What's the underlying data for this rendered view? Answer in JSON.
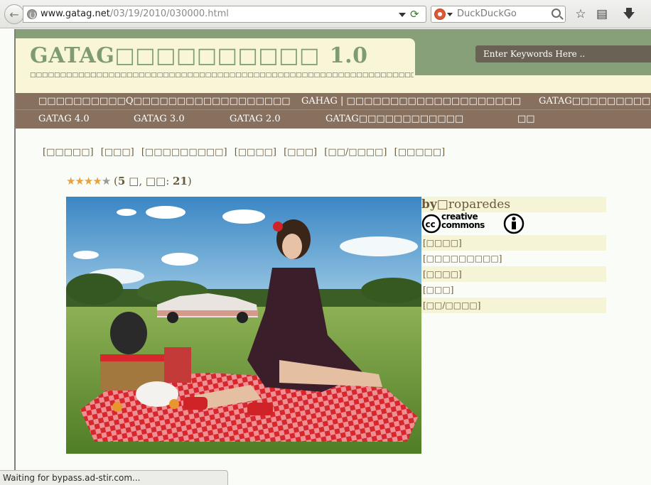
{
  "browser": {
    "url_domain": "www.gatag.net",
    "url_path": "/03/19/2010/030000.html",
    "search_placeholder": "DuckDuckGo",
    "status_text": "Waiting for bypass.ad-stir.com..."
  },
  "site": {
    "title": "GATAG□□□□□□□□□□",
    "version": "1.0",
    "tagline": "□□□□□□□□□□□□□□□□□□□□□□□□□□□□□□□□□□□□□□□□□□□□□□□□□□□□□□□□□□□□□□□□□□□□□□□□□□□□□□□□□□□□□□□□□□□□□□□□□□□□",
    "search_placeholder": "Enter Keywords Here ..",
    "accent": "#87a07a",
    "nav_color": "#87715e"
  },
  "nav": {
    "row1": [
      "□□□□□□□□□□Q□□□□□□□□□□□□□□□□□□",
      "GAHAG | □□□□□□□□□□□□□□□□□□□□",
      "GATAG□□□□□□□□□"
    ],
    "row2": [
      "GATAG 4.0",
      "GATAG 3.0",
      "GATAG 2.0",
      "GATAG□□□□□□□□□□□□",
      "□□"
    ]
  },
  "categories": [
    "[□□□□□]",
    "[□□□]",
    "[□□□□□□□□□]",
    "[□□□□]",
    "[□□□]",
    "[□□/□□□□]",
    "[□□□□□]"
  ],
  "rating": {
    "stars_filled": 4,
    "stars_total": 5,
    "score": "5",
    "score_unit": "□",
    "votes_label": "□□",
    "votes": "21"
  },
  "sidebar": {
    "author_prefix": "by",
    "author": "□roparedes",
    "cc_label": "creative commons",
    "links": [
      "[□□□□]",
      "[□□□□□□□□□]",
      "[□□□□]",
      "[□□□]",
      "[□□/□□□□]"
    ]
  },
  "photo": {
    "sky_color": "#4b95cf",
    "grass_color": "#6f9a3c",
    "blanket_color": "#d8262d",
    "dress_color": "#3a1f2a",
    "car_color": "#d69a8a"
  }
}
